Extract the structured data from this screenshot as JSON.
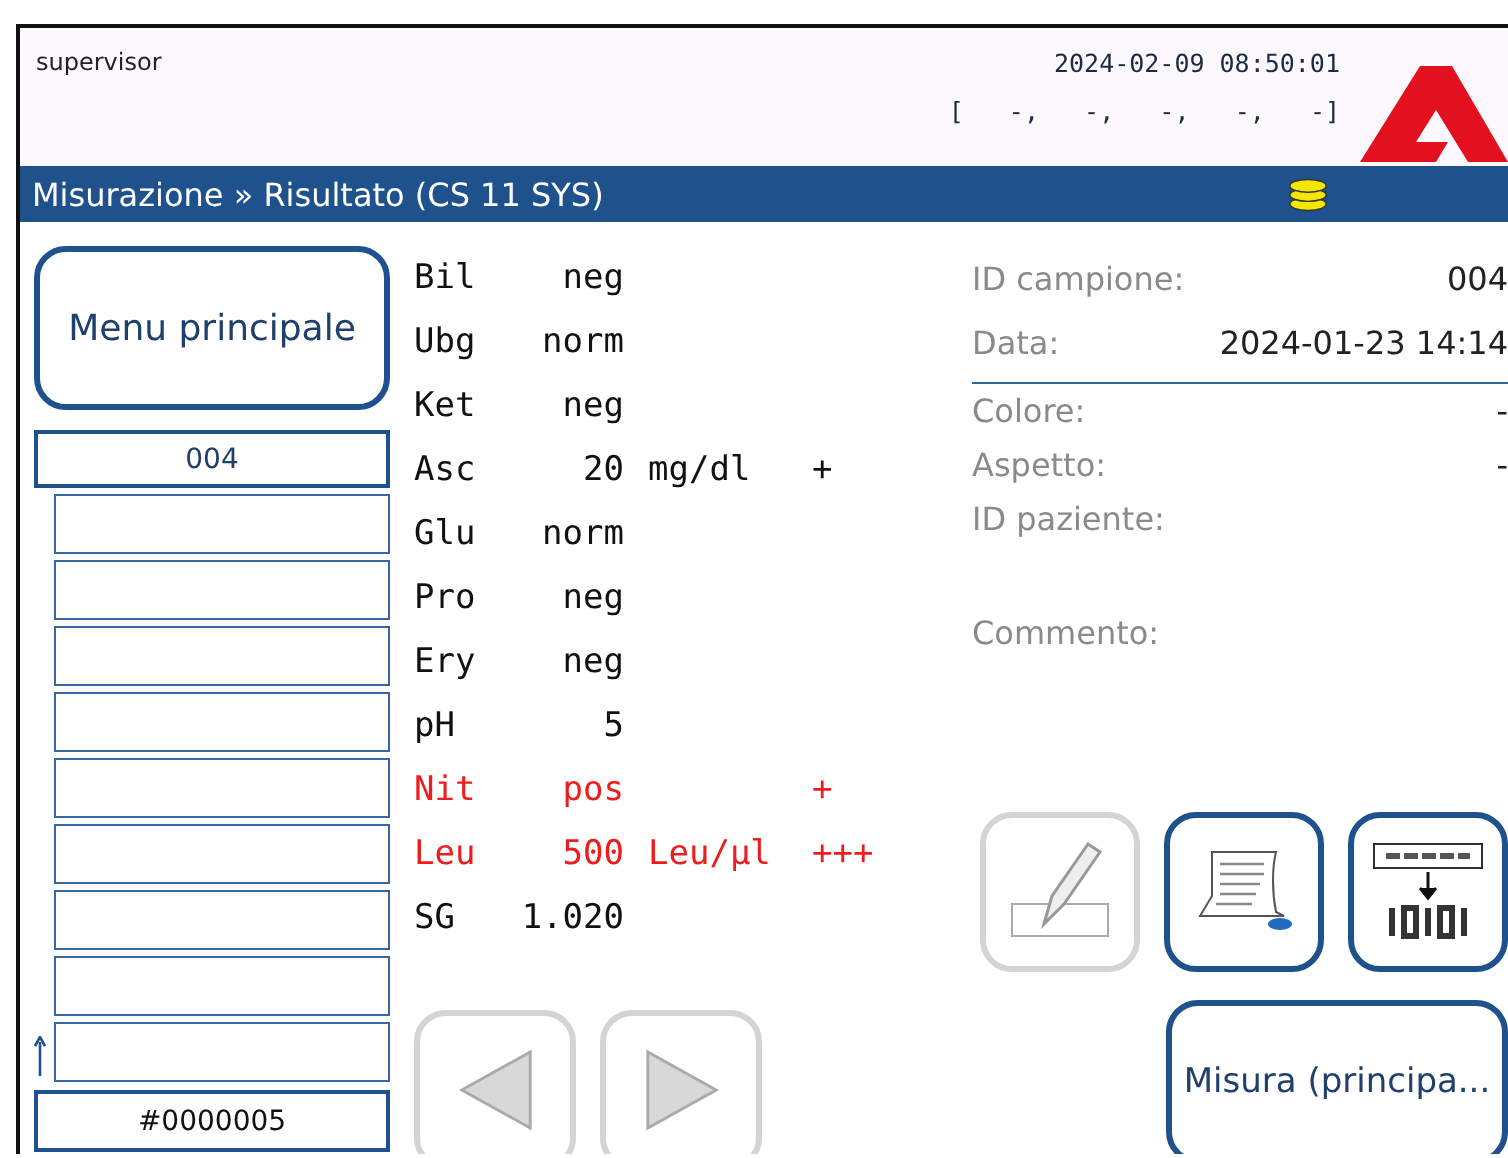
{
  "header": {
    "user": "supervisor",
    "datetime": "2024-02-09 08:50:01",
    "status": "[   -,   -,   -,   -,   -]"
  },
  "title_bar": {
    "title": "Misurazione » Risultato (CS 11 SYS)"
  },
  "sidebar": {
    "menu_button": "Menu principale",
    "items": [
      {
        "label": "004",
        "selected": true
      },
      {
        "selected": false
      },
      {
        "selected": false
      },
      {
        "selected": false
      },
      {
        "selected": false
      },
      {
        "selected": false
      },
      {
        "selected": false
      },
      {
        "selected": false
      },
      {
        "selected": false
      },
      {
        "selected": false
      }
    ],
    "counter": "#0000005"
  },
  "results": [
    {
      "name": "Bil",
      "value": "neg",
      "abnormal": false
    },
    {
      "name": "Ubg",
      "value": "norm",
      "abnormal": false
    },
    {
      "name": "Ket",
      "value": "neg",
      "abnormal": false
    },
    {
      "name": "Asc",
      "value": "20",
      "unit": "mg/dl",
      "flag": "+",
      "abnormal": false
    },
    {
      "name": "Glu",
      "value": "norm",
      "abnormal": false
    },
    {
      "name": "Pro",
      "value": "neg",
      "abnormal": false
    },
    {
      "name": "Ery",
      "value": "neg",
      "abnormal": false
    },
    {
      "name": "pH",
      "value": "5",
      "abnormal": false
    },
    {
      "name": "Nit",
      "value": "pos",
      "flag": "+",
      "abnormal": true
    },
    {
      "name": "Leu",
      "value": "500",
      "unit": "Leu/µl",
      "flag": "+++",
      "abnormal": true
    },
    {
      "name": "SG",
      "value": "1.020",
      "abnormal": false
    }
  ],
  "details": {
    "top": [
      {
        "label": "ID campione:",
        "value": "004"
      },
      {
        "label": "Data:",
        "value": "2024-01-23 14:14"
      }
    ],
    "bottom": [
      {
        "label": "Colore:",
        "value": "-"
      },
      {
        "label": "Aspetto:",
        "value": "-"
      },
      {
        "label": "ID paziente:"
      },
      {
        "label": "Commento:"
      }
    ]
  },
  "tool_buttons": [
    {
      "kind": "edit",
      "disabled": true
    },
    {
      "kind": "print",
      "disabled": false
    },
    {
      "kind": "encode",
      "disabled": false
    }
  ],
  "nav_buttons": [
    {
      "kind": "previous",
      "disabled": true
    },
    {
      "kind": "next",
      "disabled": true
    }
  ],
  "measure_button": "Misura (principa..."
}
